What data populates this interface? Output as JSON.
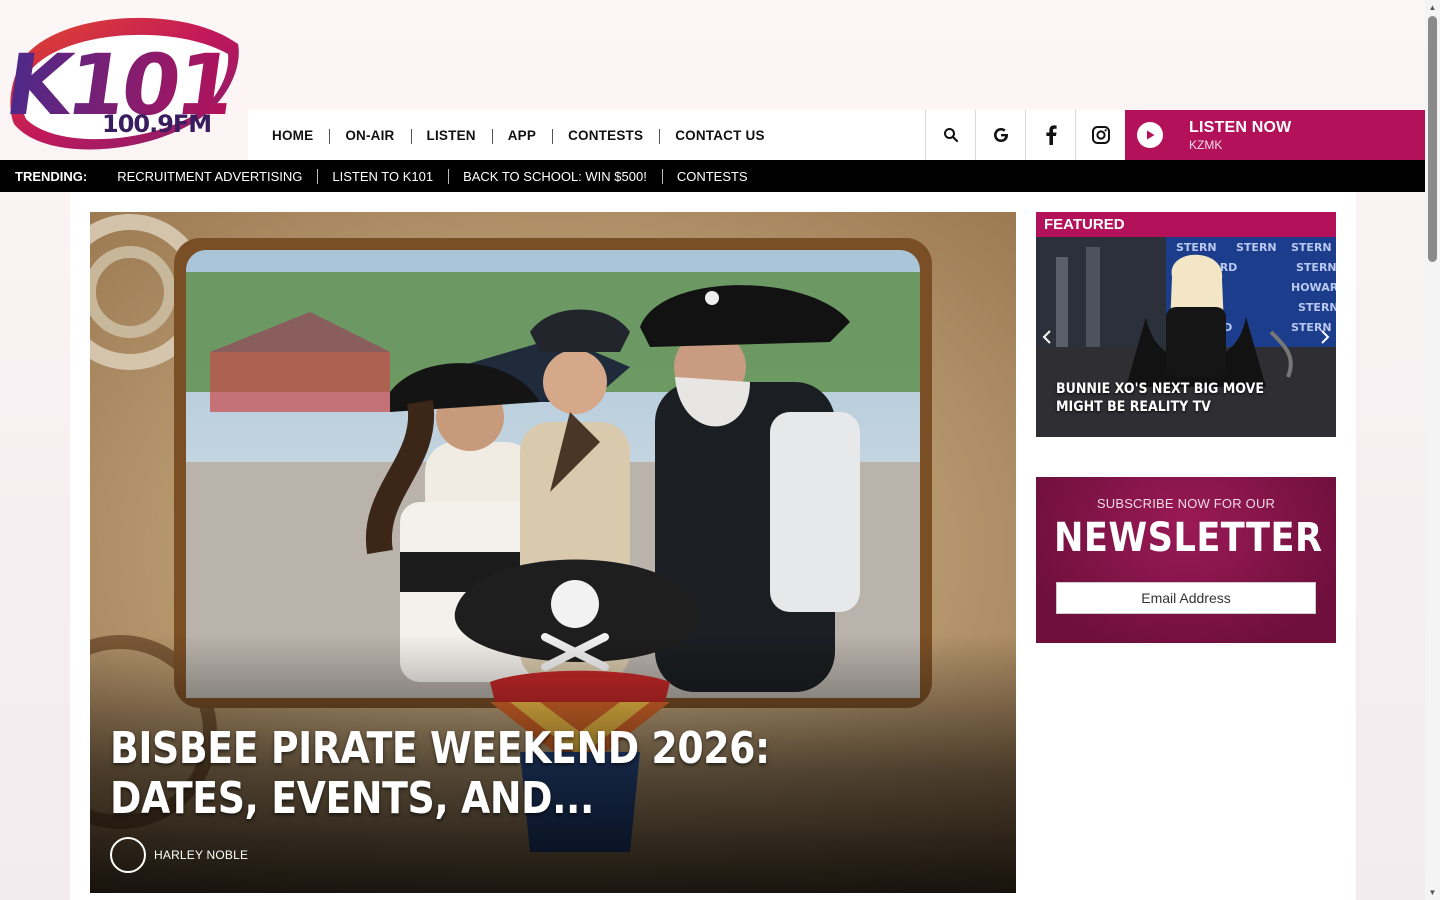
{
  "header": {
    "logo": {
      "main": "K101",
      "sub": "100.9FM"
    },
    "nav": [
      "HOME",
      "ON-AIR",
      "LISTEN",
      "APP",
      "CONTESTS",
      "CONTACT US"
    ],
    "icons": [
      "search-icon",
      "google-icon",
      "facebook-icon",
      "instagram-icon"
    ],
    "listen_now": {
      "title": "LISTEN NOW",
      "station": "KZMK"
    }
  },
  "trending": {
    "label": "TRENDING:",
    "items": [
      "RECRUITMENT ADVERTISING",
      "LISTEN TO K101",
      "BACK TO SCHOOL: WIN $500!",
      "CONTESTS"
    ]
  },
  "hero": {
    "title": "BISBEE PIRATE WEEKEND 2026: DATES, EVENTS, AND...",
    "author": "HARLEY NOBLE"
  },
  "featured": {
    "header": "FEATURED",
    "caption": "BUNNIE XO'S NEXT BIG MOVE MIGHT BE REALITY TV",
    "backdrop_words": [
      "STERN",
      "HOWARD"
    ]
  },
  "newsletter": {
    "subtitle": "SUBSCRIBE NOW FOR OUR",
    "title": "NEWSLETTER",
    "email_placeholder": "Email Address"
  },
  "colors": {
    "brand": "#b3125a",
    "newsletter_bg": "#7a1244",
    "trending_bg": "#000000"
  }
}
